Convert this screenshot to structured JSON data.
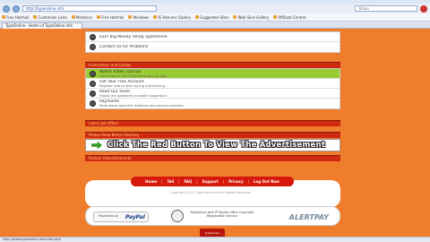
{
  "browser": {
    "address": "http://typeonline.info",
    "search_placeholder": "Yahoo",
    "bookmarks": [
      "Free Hotmail",
      "Customize Links",
      "Mentions",
      "Free Hotmail",
      "Windows",
      "IE Add-ons Gallery",
      "Suggested Sites",
      "Web Slice Gallery",
      "Affiliate Central"
    ],
    "tab_title": "TypeOnline - Home of TypeOnline.info",
    "status": "http://www.typeonline.info/click.php"
  },
  "page": {
    "top_rows": [
      {
        "title": "Earn Big Money Using TypeOnline",
        "sub": ""
      },
      {
        "title": "Contact Us for Problems",
        "sub": ""
      }
    ],
    "section1_title": "Instructions and Guides",
    "section1_rows": [
      {
        "title": "Watch Video Tutorial",
        "sub": "Learn how to use TypeOnline step by step.",
        "highlight": true
      },
      {
        "title": "Get Your Free Account",
        "sub": "Register now to start typing and earning.",
        "highlight": false
      },
      {
        "title": "Read Our Rules",
        "sub": "Follow the guidelines to avoid suspension.",
        "highlight": false
      },
      {
        "title": "Payments",
        "sub": "Read about payment methods and payout schedule.",
        "highlight": false
      }
    ],
    "section2_title": "Latest Job Offers",
    "section3_title": "Please Read Before Starting",
    "ad_text": "Click The Red Button To View The Advertisement",
    "section4_title": "Partner Advertisements",
    "menu": [
      "Home",
      "Tell",
      "FAQ",
      "Support",
      "Privacy",
      "Log Out Now"
    ],
    "copyright": "Copyright 2010 TypeOnline.info All Rights Reserved",
    "paypal_small": "Payments by",
    "paypal_brand": "PayPal",
    "registration": "Registered with IP Rights Office Copyright Registration Service",
    "alertpay": "ALERTPAY",
    "bottom_logo": "TypeOnline"
  }
}
